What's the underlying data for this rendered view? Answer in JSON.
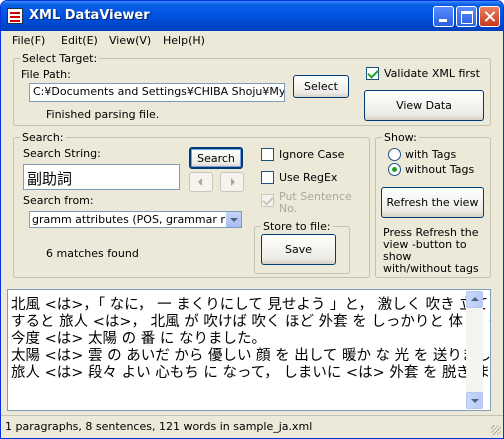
{
  "window": {
    "title": "XML DataViewer"
  },
  "menu": {
    "items": [
      "File(F)",
      "Edit(E)",
      "View(V)",
      "Help(H)"
    ]
  },
  "select_target": {
    "group_label": "Select Target:",
    "file_path_label": "File Path:",
    "file_path_value": "C:¥Documents and Settings¥CHIBA Shoju¥My Do",
    "select_button": "Select",
    "status": "Finished parsing file.",
    "validate_label": "Validate XML first",
    "validate_checked": true,
    "view_data_button": "View Data"
  },
  "search": {
    "group_label": "Search:",
    "string_label": "Search String:",
    "string_value": "副助詞",
    "search_button": "Search",
    "ignore_case_label": "Ignore Case",
    "use_regex_label": "Use RegEx",
    "put_sentence_label": "Put Sentence No.",
    "search_from_label": "Search from:",
    "search_from_value": "gramm attributes (POS, grammar note",
    "matches": "6 matches found",
    "store_group_label": "Store to file:",
    "save_button": "Save"
  },
  "show": {
    "group_label": "Show:",
    "with_tags": "with Tags",
    "without_tags": "without Tags",
    "selected": "without Tags",
    "refresh_button": "Refresh the view",
    "help_text": "Press Refresh the view -button to show with/without tags"
  },
  "results": {
    "lines": [
      "北風 <は>，「 なに， 一 まくりにして 見せよう 」と， 激しく 吹き 立て",
      "すると 旅人 <は>， 北風 が 吹けば 吹く ほど 外套 を しっかりと 体 に く",
      "今度 <は> 太陽 の 番 に なりました。",
      "太陽 <は> 雲 の あいだ から 優しい 顔 を 出して 暖か な 光 を 送りまし",
      "旅人 <は> 段々 よい 心もち に なって， しまいに <は> 外套 を 脱ぎ ま"
    ]
  },
  "status_bar": {
    "text": "1 paragraphs, 8 sentences, 121 words in sample_ja.xml"
  }
}
